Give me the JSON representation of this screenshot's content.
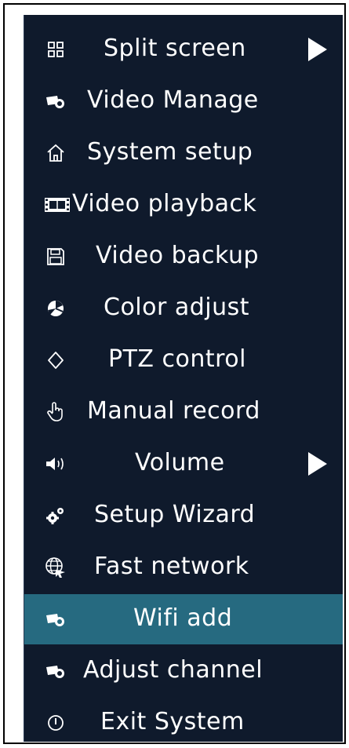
{
  "menu": {
    "items": [
      {
        "label": "Split screen",
        "icon": "split-screen-icon",
        "submenu": true
      },
      {
        "label": "Video Manage",
        "icon": "camera-icon",
        "submenu": false
      },
      {
        "label": "System setup",
        "icon": "home-icon",
        "submenu": false
      },
      {
        "label": "Video playback",
        "icon": "film-icon",
        "submenu": false
      },
      {
        "label": "Video backup",
        "icon": "floppy-disk-icon",
        "submenu": false
      },
      {
        "label": "Color adjust",
        "icon": "palette-icon",
        "submenu": false
      },
      {
        "label": "PTZ control",
        "icon": "ptz-icon",
        "submenu": false
      },
      {
        "label": "Manual record",
        "icon": "hand-pointer-icon",
        "submenu": false
      },
      {
        "label": "Volume",
        "icon": "speaker-icon",
        "submenu": true
      },
      {
        "label": "Setup Wizard",
        "icon": "gears-icon",
        "submenu": false
      },
      {
        "label": "Fast network",
        "icon": "globe-icon",
        "submenu": false
      },
      {
        "label": "Wifi add",
        "icon": "camera-icon",
        "submenu": false,
        "selected": true
      },
      {
        "label": "Adjust channel",
        "icon": "camera-icon",
        "submenu": false
      },
      {
        "label": "Exit System",
        "icon": "power-icon",
        "submenu": false
      }
    ]
  },
  "colors": {
    "menu_background": "#0f1a2c",
    "selected_background": "#266a80",
    "text": "#ffffff"
  }
}
